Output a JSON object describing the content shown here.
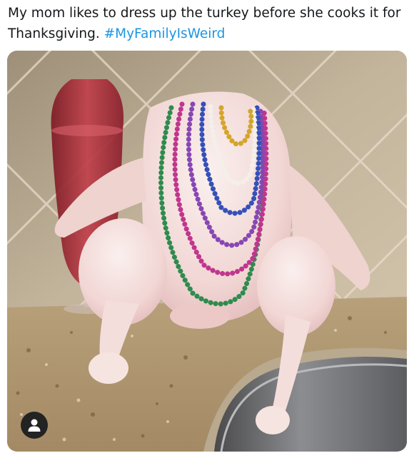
{
  "tweet": {
    "text": "My mom likes to dress up the turkey before she cooks it for Thanksgiving. ",
    "hashtag": "#MyFamilyIsWeird",
    "accent_color": "#1b95e0"
  },
  "media": {
    "alt": "Raw turkey posed seated on a granite countertop wearing colorful bead necklaces, next to a glass of red drink",
    "account_icon": "user-icon"
  }
}
